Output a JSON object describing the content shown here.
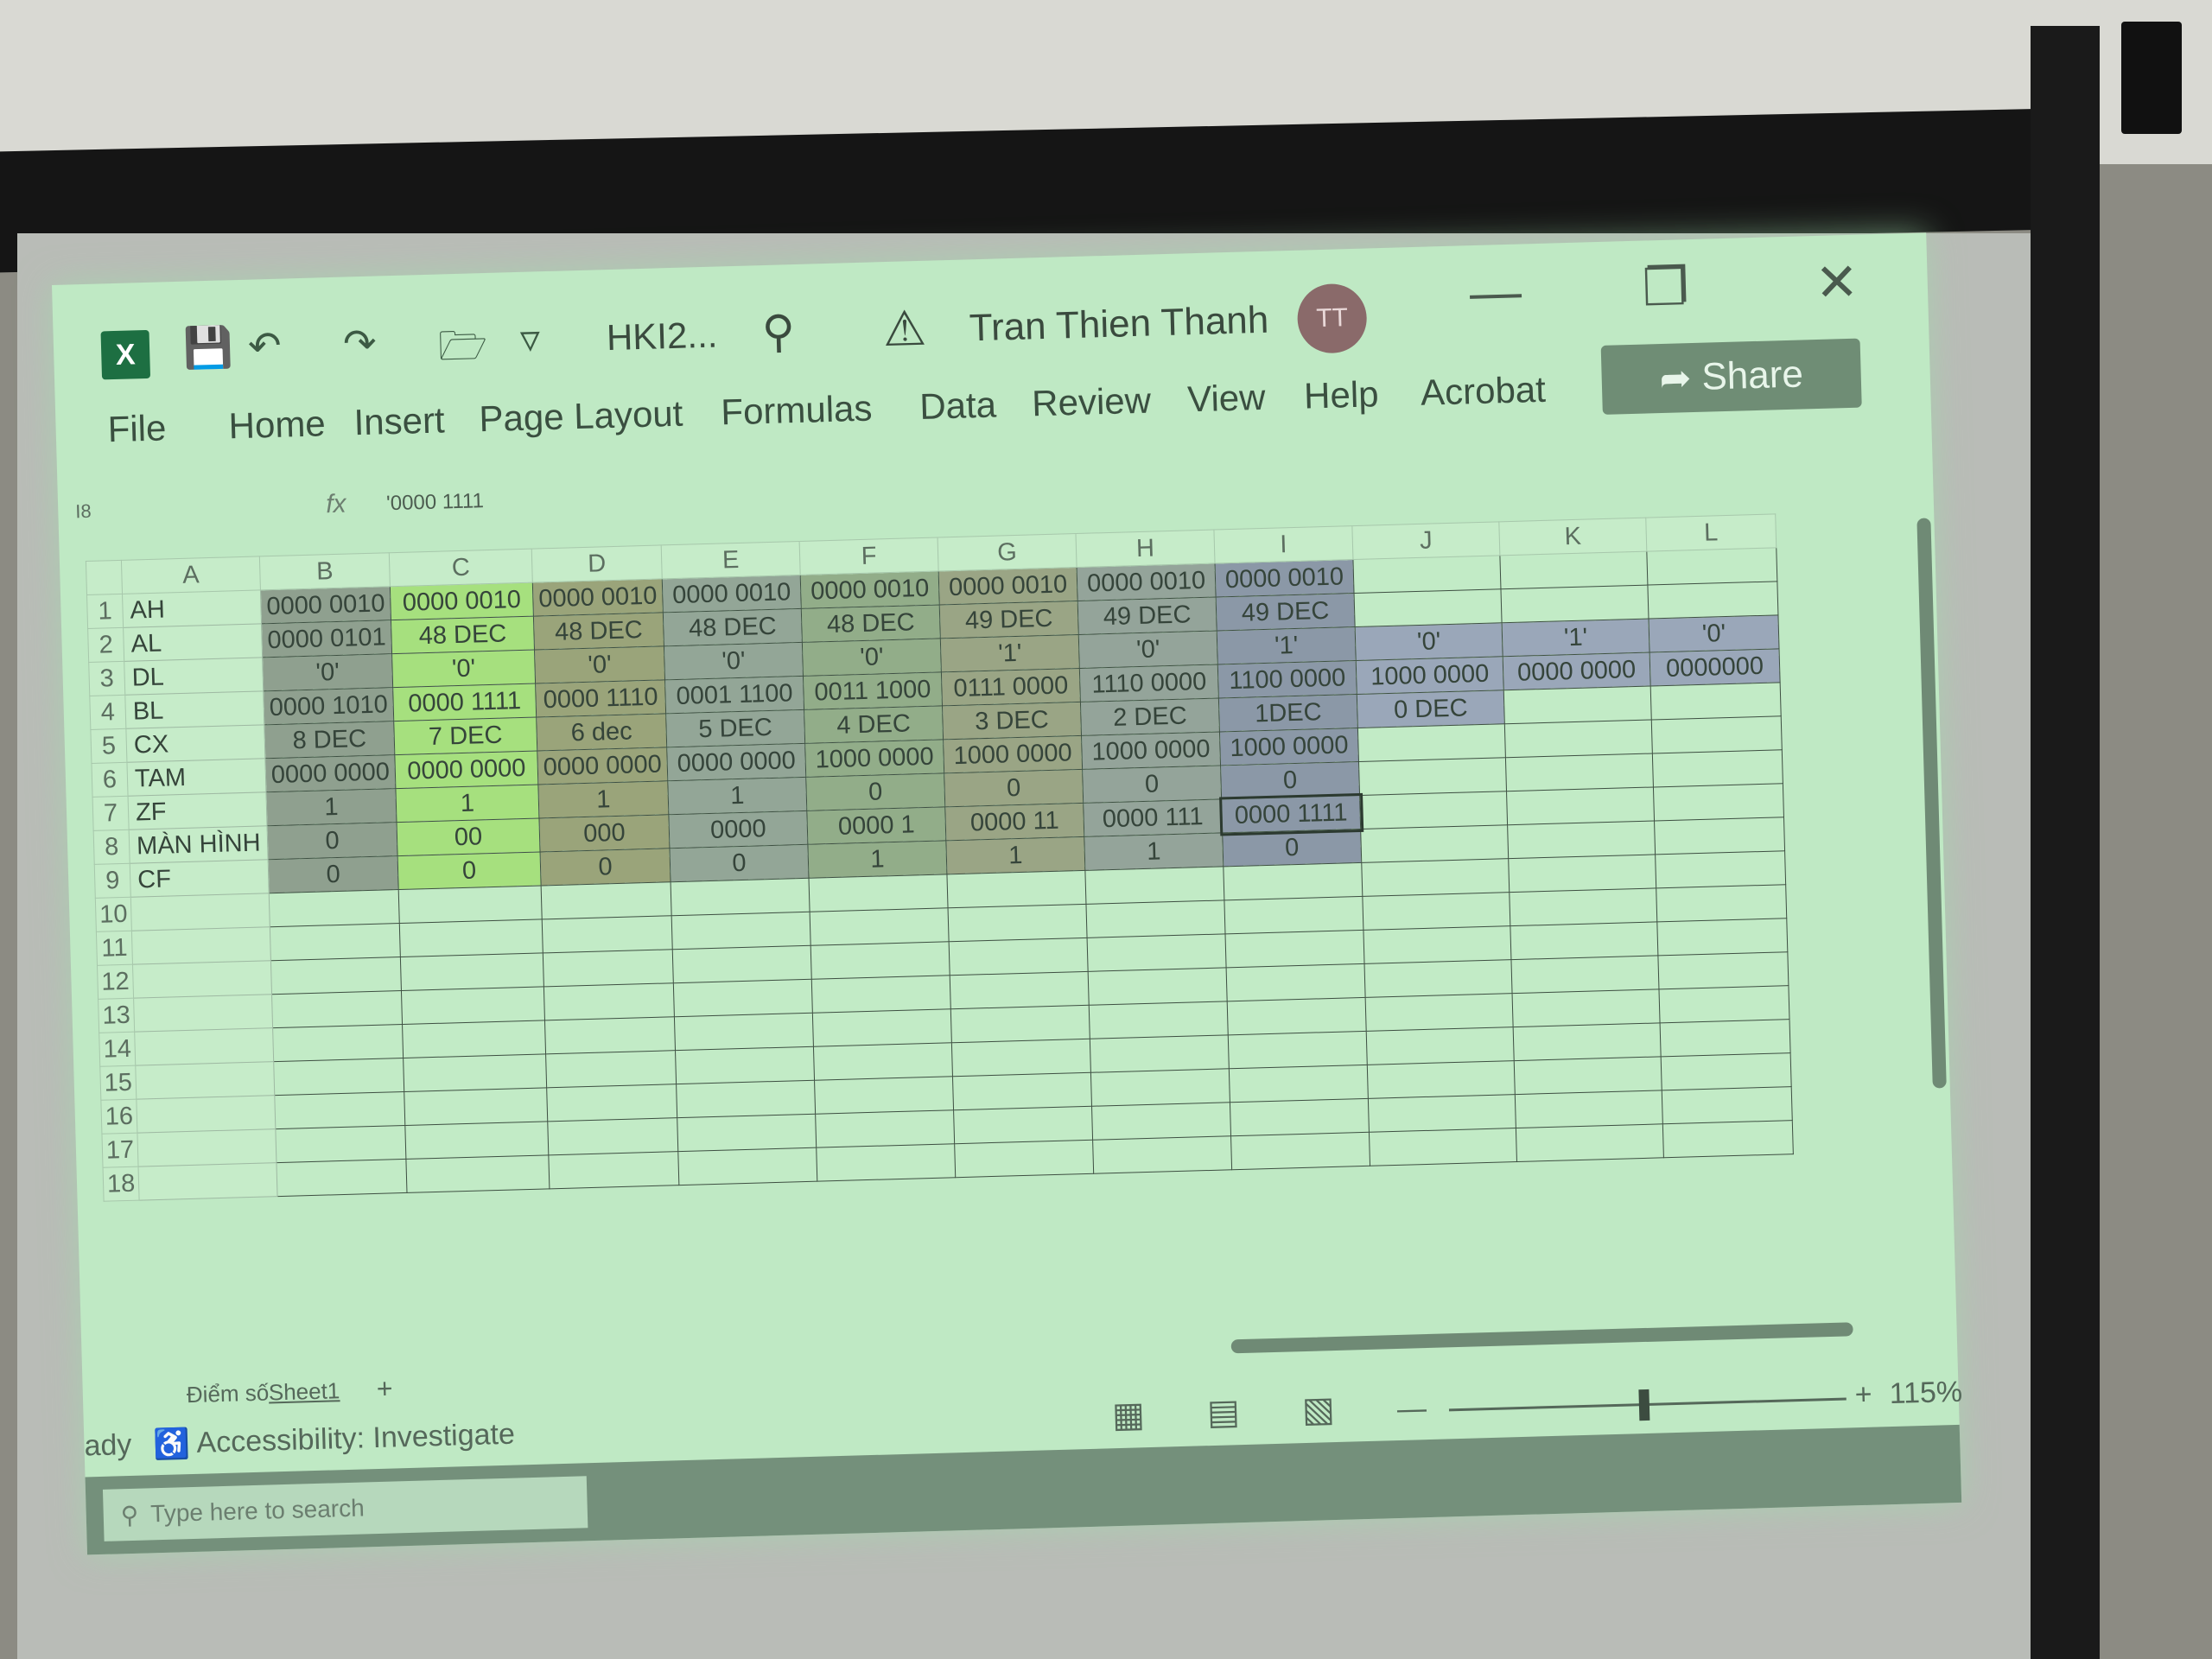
{
  "window": {
    "app_icon": "excel-icon",
    "doc_title": "HKI2...",
    "user_name": "Tran Thien Thanh",
    "avatar_initials": "TT"
  },
  "ribbon": {
    "tabs": [
      "File",
      "Home",
      "Insert",
      "Page Layout",
      "Formulas",
      "Data",
      "Review",
      "View",
      "Help",
      "Acrobat"
    ],
    "share_label": "Share"
  },
  "formula_bar": {
    "name_box": "I8",
    "fx_label": "fx",
    "value": "'0000 1111"
  },
  "columns": [
    "A",
    "B",
    "C",
    "D",
    "E",
    "F",
    "G",
    "H",
    "I",
    "J",
    "K",
    "L"
  ],
  "rows": [
    {
      "n": "1",
      "label": "AH",
      "cells": [
        "0000 0010",
        "0000 0010",
        "0000 0010",
        "0000 0010",
        "0000 0010",
        "0000 0010",
        "0000 0010",
        "0000 0010",
        "",
        "",
        ""
      ]
    },
    {
      "n": "2",
      "label": "AL",
      "cells": [
        "0000 0101",
        "48 DEC",
        "48 DEC",
        "48 DEC",
        "48 DEC",
        "49 DEC",
        "49 DEC",
        "49 DEC",
        "",
        "",
        ""
      ]
    },
    {
      "n": "3",
      "label": "DL",
      "cells": [
        "'0'",
        "'0'",
        "'0'",
        "'0'",
        "'0'",
        "'1'",
        "'0'",
        "'1'",
        "'0'",
        "'1'",
        "'0'"
      ]
    },
    {
      "n": "4",
      "label": "BL",
      "cells": [
        "0000 1010",
        "0000 1111",
        "0000 1110",
        "0001 1100",
        "0011 1000",
        "0111 0000",
        "1110 0000",
        "1100 0000",
        "1000 0000",
        "0000 0000",
        "0000000"
      ]
    },
    {
      "n": "5",
      "label": "CX",
      "cells": [
        "8 DEC",
        "7 DEC",
        "6 dec",
        "5 DEC",
        "4 DEC",
        "3 DEC",
        "2 DEC",
        "1DEC",
        "0 DEC",
        "",
        ""
      ]
    },
    {
      "n": "6",
      "label": "TAM",
      "cells": [
        "0000 0000",
        "0000 0000",
        "0000 0000",
        "0000 0000",
        "1000 0000",
        "1000 0000",
        "1000 0000",
        "1000 0000",
        "",
        "",
        ""
      ]
    },
    {
      "n": "7",
      "label": "ZF",
      "cells": [
        "1",
        "1",
        "1",
        "1",
        "0",
        "0",
        "0",
        "0",
        "",
        "",
        ""
      ]
    },
    {
      "n": "8",
      "label": "MÀN HÌNH",
      "cells": [
        "0",
        "00",
        "000",
        "0000",
        "0000 1",
        "0000 11",
        "0000 111",
        "0000 1111",
        "",
        "",
        ""
      ]
    },
    {
      "n": "9",
      "label": "CF",
      "cells": [
        "0",
        "0",
        "0",
        "0",
        "1",
        "1",
        "1",
        "0",
        "",
        "",
        ""
      ]
    },
    {
      "n": "10",
      "label": "",
      "cells": [
        "",
        "",
        "",
        "",
        "",
        "",
        "",
        "",
        "",
        "",
        ""
      ]
    },
    {
      "n": "11",
      "label": "",
      "cells": [
        "",
        "",
        "",
        "",
        "",
        "",
        "",
        "",
        "",
        "",
        ""
      ]
    },
    {
      "n": "12",
      "label": "",
      "cells": [
        "",
        "",
        "",
        "",
        "",
        "",
        "",
        "",
        "",
        "",
        ""
      ]
    },
    {
      "n": "13",
      "label": "",
      "cells": [
        "",
        "",
        "",
        "",
        "",
        "",
        "",
        "",
        "",
        "",
        ""
      ]
    },
    {
      "n": "14",
      "label": "",
      "cells": [
        "",
        "",
        "",
        "",
        "",
        "",
        "",
        "",
        "",
        "",
        ""
      ]
    },
    {
      "n": "15",
      "label": "",
      "cells": [
        "",
        "",
        "",
        "",
        "",
        "",
        "",
        "",
        "",
        "",
        ""
      ]
    },
    {
      "n": "16",
      "label": "",
      "cells": [
        "",
        "",
        "",
        "",
        "",
        "",
        "",
        "",
        "",
        "",
        ""
      ]
    },
    {
      "n": "17",
      "label": "",
      "cells": [
        "",
        "",
        "",
        "",
        "",
        "",
        "",
        "",
        "",
        "",
        ""
      ]
    },
    {
      "n": "18",
      "label": "",
      "cells": [
        "",
        "",
        "",
        "",
        "",
        "",
        "",
        "",
        "",
        "",
        ""
      ]
    }
  ],
  "sheet_tabs": [
    "Điểm số",
    "Sheet1"
  ],
  "add_sheet": "+",
  "status": {
    "ready": "ady",
    "accessibility": "Accessibility: Investigate",
    "zoom": "115%"
  },
  "taskbar": {
    "search_placeholder": "Type here to search"
  }
}
